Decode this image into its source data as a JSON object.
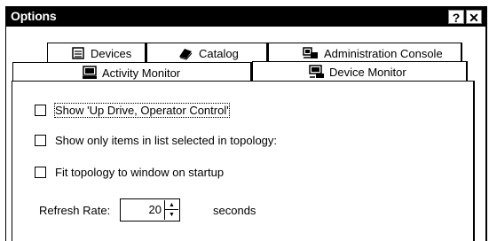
{
  "window": {
    "title": "Options",
    "help_label": "?",
    "close_label": "✕"
  },
  "tabs": {
    "row1": [
      {
        "label": "Devices",
        "icon": "devices-icon"
      },
      {
        "label": "Catalog",
        "icon": "catalog-icon"
      },
      {
        "label": "Administration Console",
        "icon": "administration-console-icon"
      }
    ],
    "row2": [
      {
        "label": "Activity Monitor",
        "icon": "activity-monitor-icon"
      },
      {
        "label": "Device Monitor",
        "icon": "device-monitor-icon",
        "selected": true
      }
    ]
  },
  "options": [
    {
      "label": "Show 'Up Drive, Operator Control'",
      "checked": false
    },
    {
      "label": "Show only items in list selected in topology:",
      "checked": false
    },
    {
      "label": "Fit topology to window on startup",
      "checked": false
    }
  ],
  "refresh": {
    "label": "Refresh Rate:",
    "value": "20",
    "units": "seconds"
  }
}
